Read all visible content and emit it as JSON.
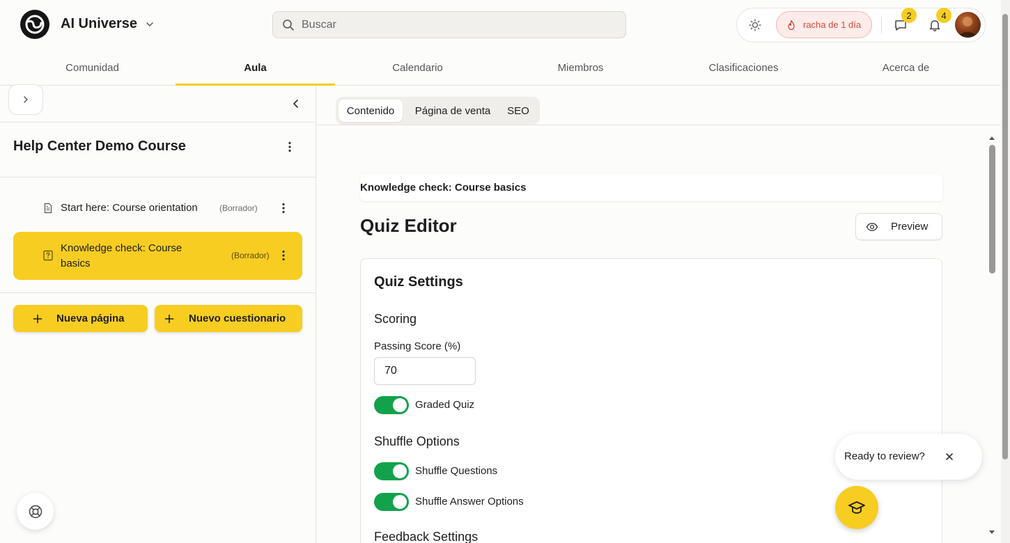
{
  "header": {
    "app_name": "AI Universe",
    "search_placeholder": "Buscar",
    "streak_label": "racha de 1 día",
    "messages_count": "2",
    "notifications_count": "4"
  },
  "nav": {
    "tabs": [
      {
        "label": "Comunidad"
      },
      {
        "label": "Aula"
      },
      {
        "label": "Calendario"
      },
      {
        "label": "Miembros"
      },
      {
        "label": "Clasificaciones"
      },
      {
        "label": "Acerca de"
      }
    ],
    "active": "Aula"
  },
  "sidebar": {
    "course_title": "Help Center Demo Course",
    "lessons": [
      {
        "title": "Start here: Course orientation",
        "status": "(Borrador)",
        "icon": "document-icon"
      },
      {
        "title": "Knowledge check: Course basics",
        "status": "(Borrador)",
        "icon": "quiz-icon"
      }
    ],
    "new_page_label": "Nueva página",
    "new_quiz_label": "Nuevo cuestionario"
  },
  "main": {
    "subtabs": [
      {
        "label": "Contenido"
      },
      {
        "label": "Página de venta"
      },
      {
        "label": "SEO"
      }
    ],
    "active_subtab": "Contenido",
    "lesson_name": "Knowledge check: Course basics",
    "editor_title": "Quiz Editor",
    "preview_label": "Preview",
    "settings": {
      "title": "Quiz Settings",
      "scoring_title": "Scoring",
      "passing_score_label": "Passing Score (%)",
      "passing_score_value": "70",
      "graded_quiz_label": "Graded Quiz",
      "graded_quiz_on": true,
      "shuffle_title": "Shuffle Options",
      "shuffle_questions_label": "Shuffle Questions",
      "shuffle_questions_on": true,
      "shuffle_answers_label": "Shuffle Answer Options",
      "shuffle_answers_on": true,
      "feedback_title": "Feedback Settings"
    }
  },
  "review_popover": {
    "text": "Ready to review?"
  },
  "colors": {
    "accent_yellow": "#f7cd22",
    "toggle_green": "#12a24b",
    "streak_red": "#d64a35"
  }
}
